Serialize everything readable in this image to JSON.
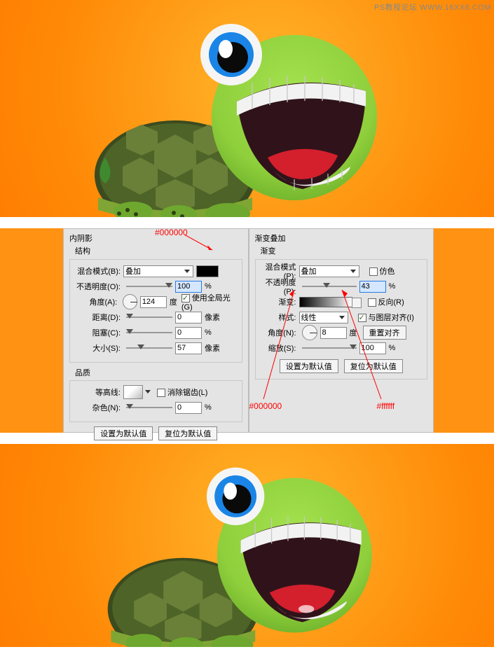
{
  "watermark": "PS教程论坛 WWW.16XX8.COM",
  "panel_left": {
    "title": "内阴影",
    "section1": "结构",
    "section2": "品质",
    "blend_mode_label": "混合模式(B):",
    "blend_mode_value": "叠加",
    "opacity_label": "不透明度(O):",
    "opacity_value": "100",
    "angle_label": "角度(A):",
    "angle_value": "124",
    "angle_unit": "度",
    "use_global_label": "使用全局光(G)",
    "distance_label": "距离(D):",
    "distance_value": "0",
    "distance_unit": "像素",
    "choke_label": "阻塞(C):",
    "choke_value": "0",
    "size_label": "大小(S):",
    "size_value": "57",
    "size_unit": "像素",
    "contour_label": "等高线:",
    "antialias_label": "消除锯齿(L)",
    "noise_label": "杂色(N):",
    "noise_value": "0",
    "btn_default": "设置为默认值",
    "btn_reset": "复位为默认值",
    "annot_color": "#000000"
  },
  "panel_right": {
    "title": "渐变叠加",
    "section1": "渐变",
    "blend_mode_label": "混合模式(P):",
    "blend_mode_value": "叠加",
    "dither_label": "仿色",
    "opacity_label": "不透明度(P):",
    "opacity_value": "43",
    "gradient_label": "渐变:",
    "reverse_label": "反向(R)",
    "style_label": "样式:",
    "style_value": "线性",
    "align_label": "与图层对齐(I)",
    "angle_label": "角度(N):",
    "angle_value": "8",
    "angle_unit": "度",
    "reset_align_label": "重置对齐",
    "scale_label": "缩放(S):",
    "scale_value": "100",
    "btn_default": "设置为默认值",
    "btn_reset": "复位为默认值",
    "annot_black": "#000000",
    "annot_white": "#ffffff"
  },
  "grad_colors": {
    "start": "#000000",
    "end": "#ffffff"
  }
}
